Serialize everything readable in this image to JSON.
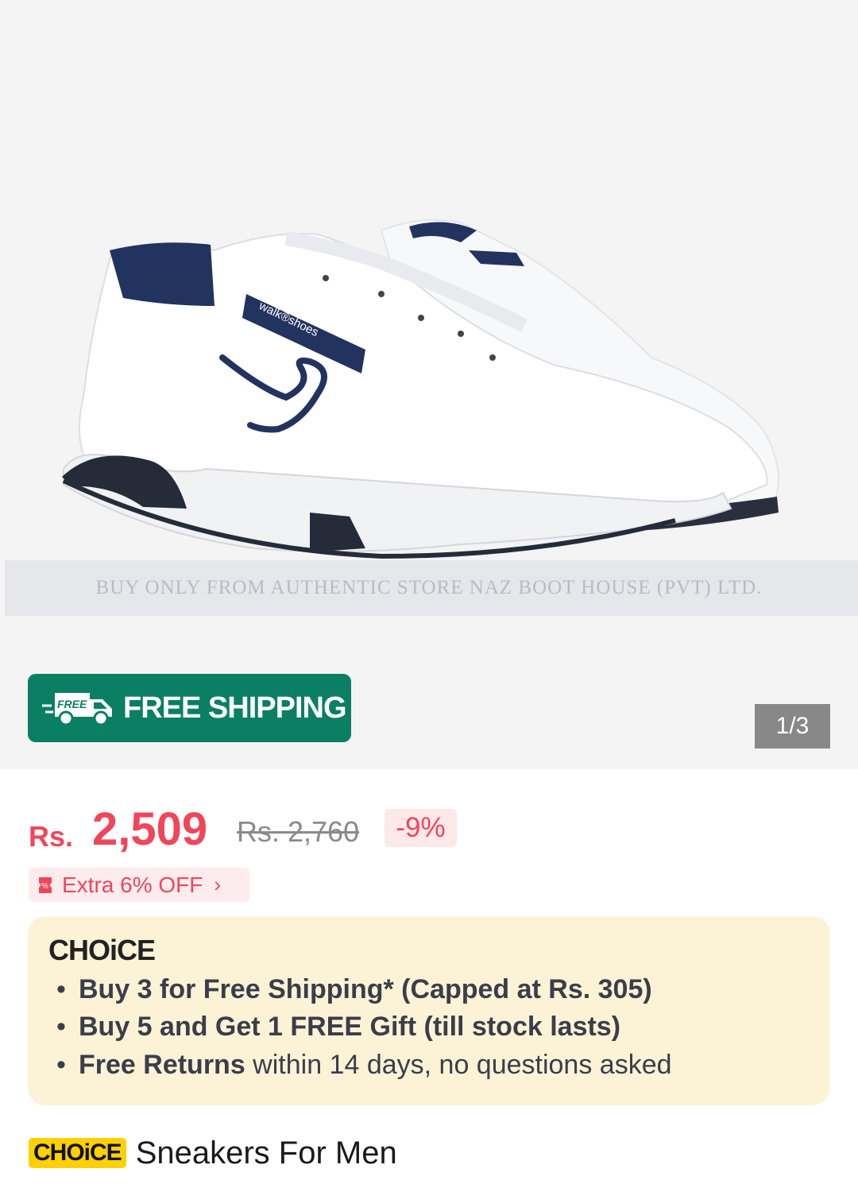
{
  "hero": {
    "watermark": "BUY ONLY FROM AUTHENTIC STORE NAZ BOOT HOUSE (PVT) LTD.",
    "shoe_branding": "walk®shoes",
    "shipping_badge": {
      "icon_text": "FREE",
      "label": "FREE SHIPPING",
      "color": "#0a7f63"
    },
    "pager": "1/3"
  },
  "price": {
    "currency": "Rs.",
    "current": "2,509",
    "original": "Rs. 2,760",
    "discount": "-9%",
    "accent_color": "#f0465a"
  },
  "voucher": {
    "label": "Extra 6% OFF",
    "chevron": "›"
  },
  "choice": {
    "logo": "CHOiCE",
    "benefits": [
      {
        "bullet": "•",
        "bold": "Buy 3 for  Free Shipping* (Capped at Rs. 305)",
        "rest": ""
      },
      {
        "bullet": "•",
        "bold": "Buy 5 and Get 1 FREE Gift (till stock lasts)",
        "rest": ""
      },
      {
        "bullet": "•",
        "bold": "Free Returns",
        "rest": " within 14 days, no questions asked"
      }
    ]
  },
  "product": {
    "badge": "CHOiCE",
    "title": "Sneakers For Men"
  }
}
